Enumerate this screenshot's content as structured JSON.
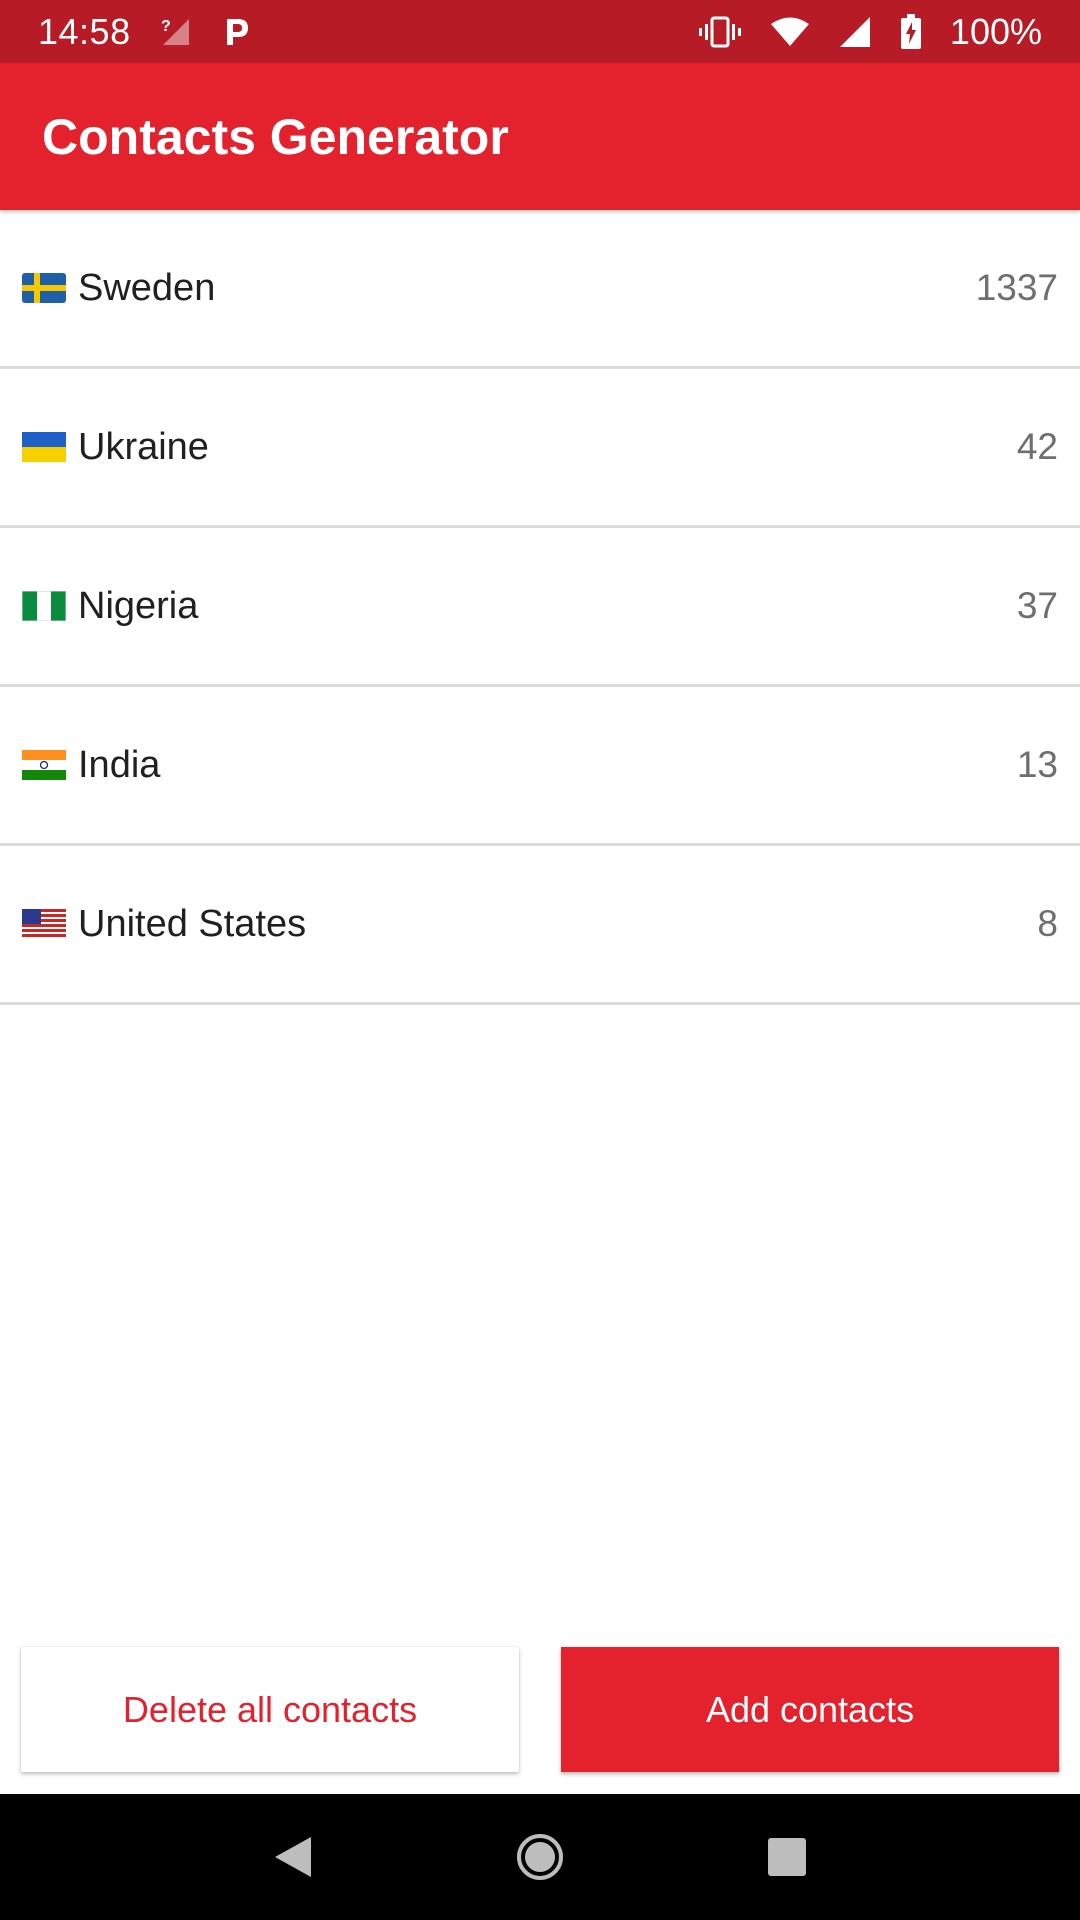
{
  "status_bar": {
    "time": "14:58",
    "battery": "100%",
    "icons": [
      "no-signal-icon",
      "parking-p-icon",
      "vibrate-icon",
      "wifi-icon",
      "cell-signal-icon",
      "battery-charging-icon"
    ]
  },
  "app_bar": {
    "title": "Contacts Generator"
  },
  "countries": [
    {
      "name": "Sweden",
      "count": "1337",
      "flag": "sweden-flag-icon"
    },
    {
      "name": "Ukraine",
      "count": "42",
      "flag": "ukraine-flag-icon"
    },
    {
      "name": "Nigeria",
      "count": "37",
      "flag": "nigeria-flag-icon"
    },
    {
      "name": "India",
      "count": "13",
      "flag": "india-flag-icon"
    },
    {
      "name": "United States",
      "count": "8",
      "flag": "usa-flag-icon"
    }
  ],
  "buttons": {
    "delete_label": "Delete all contacts",
    "add_label": "Add contacts"
  },
  "colors": {
    "primary": "#e3222e",
    "primary_dark": "#b71c26",
    "divider": "#dcdcdc",
    "count_text": "#6e6e6e"
  },
  "nav_bar": {
    "icons": [
      "back-icon",
      "home-icon",
      "recents-icon"
    ]
  }
}
